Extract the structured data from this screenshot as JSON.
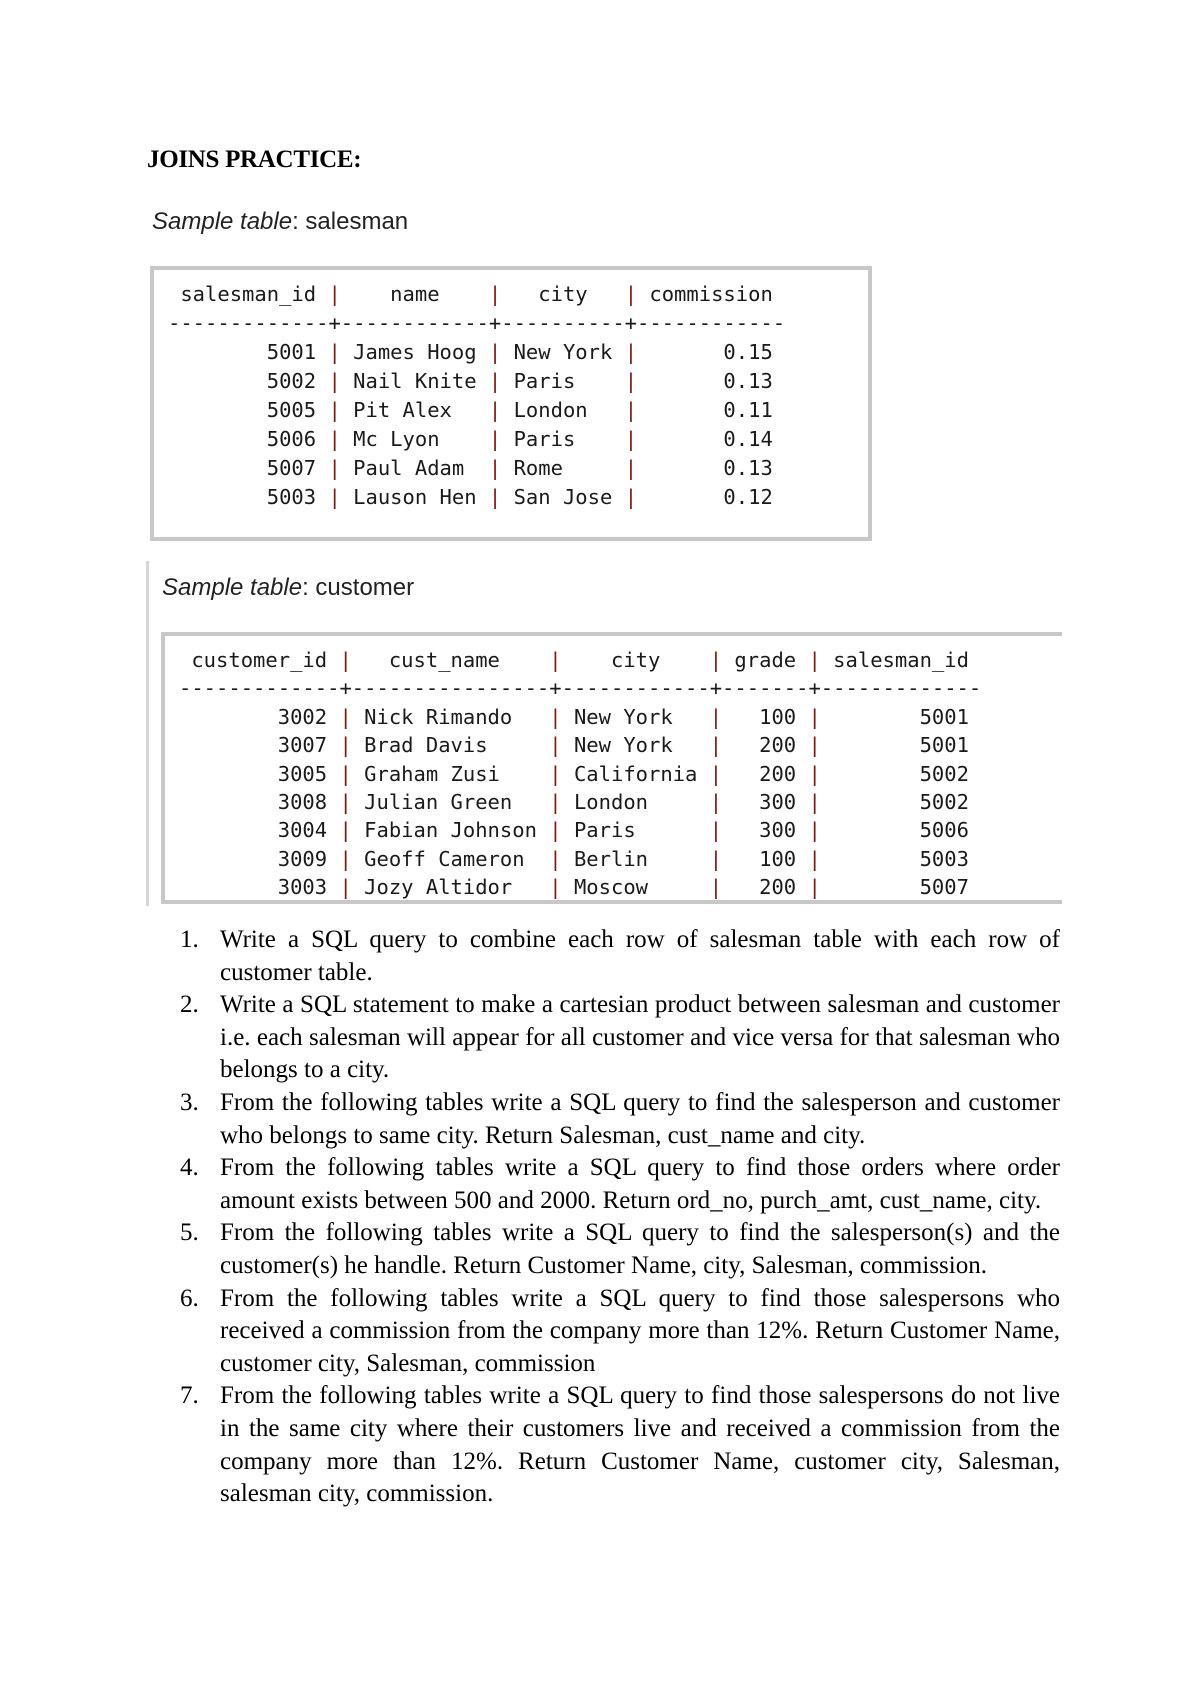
{
  "document": {
    "title": "JOINS PRACTICE:"
  },
  "salesman_table": {
    "caption_prefix": "Sample table",
    "caption_suffix": ": salesman",
    "columns": [
      "salesman_id",
      "name",
      "city",
      "commission"
    ],
    "rows": [
      [
        "5001",
        "James Hoog",
        "New York",
        "0.15"
      ],
      [
        "5002",
        "Nail Knite",
        "Paris",
        "0.13"
      ],
      [
        "5005",
        "Pit Alex",
        "London",
        "0.11"
      ],
      [
        "5006",
        "Mc Lyon",
        "Paris",
        "0.14"
      ],
      [
        "5007",
        "Paul Adam",
        "Rome",
        "0.13"
      ],
      [
        "5003",
        "Lauson Hen",
        "San Jose",
        "0.12"
      ]
    ]
  },
  "customer_table": {
    "caption_prefix": "Sample table",
    "caption_suffix": ": customer",
    "columns": [
      "customer_id",
      "cust_name",
      "city",
      "grade",
      "salesman_id"
    ],
    "rows": [
      [
        "3002",
        "Nick Rimando",
        "New York",
        "100",
        "5001"
      ],
      [
        "3007",
        "Brad Davis",
        "New York",
        "200",
        "5001"
      ],
      [
        "3005",
        "Graham Zusi",
        "California",
        "200",
        "5002"
      ],
      [
        "3008",
        "Julian Green",
        "London",
        "300",
        "5002"
      ],
      [
        "3004",
        "Fabian Johnson",
        "Paris",
        "300",
        "5006"
      ],
      [
        "3009",
        "Geoff Cameron",
        "Berlin",
        "100",
        "5003"
      ],
      [
        "3003",
        "Jozy Altidor",
        "Moscow",
        "200",
        "5007"
      ]
    ]
  },
  "questions": [
    {
      "num": "1.",
      "text": "Write a SQL query to combine each row of salesman table with each row of customer table."
    },
    {
      "num": "2.",
      "text": "Write a SQL statement to make a cartesian product between salesman and customer i.e. each salesman will appear for all customer and vice versa for that salesman who belongs to a city."
    },
    {
      "num": "3.",
      "text": "From the following tables write a SQL query to find the salesperson and customer who belongs to same city. Return Salesman, cust_name and city."
    },
    {
      "num": "4.",
      "text": "From the following tables write a SQL query to find those orders where order amount exists between 500 and 2000. Return ord_no, purch_amt, cust_name, city."
    },
    {
      "num": "5.",
      "text": "From the following tables write a SQL query to find the salesperson(s) and the customer(s) he handle. Return Customer Name, city, Salesman, commission."
    },
    {
      "num": "6.",
      "text": "From the following tables write a SQL query to find those salespersons who received a commission from the company more than 12%. Return Customer Name, customer city, Salesman, commission"
    },
    {
      "num": "7.",
      "text": "From the following tables write a SQL query to find those salespersons do not live in the same city where their customers live and received a commission from the company more than 12%. Return Customer Name, customer city, Salesman, salesman city, commission."
    }
  ]
}
